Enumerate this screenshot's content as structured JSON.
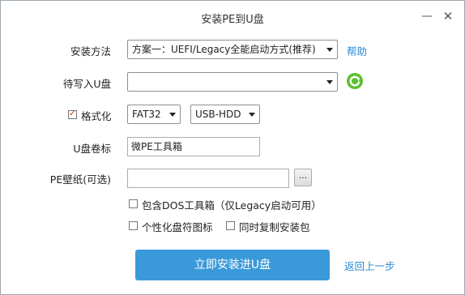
{
  "window": {
    "title": "安装PE到U盘",
    "minimize_icon": "minimize-icon",
    "close_icon": "close-icon"
  },
  "install_method": {
    "label": "安装方法",
    "value": "方案一：UEFI/Legacy全能启动方式(推荐)",
    "help": "帮助"
  },
  "target_drive": {
    "label": "待写入U盘",
    "value": "",
    "refresh_icon": "refresh-icon"
  },
  "format": {
    "label": "格式化",
    "checked": true,
    "filesystem": "FAT32",
    "mode": "USB-HDD"
  },
  "volume_label": {
    "label": "U盘卷标",
    "value": "微PE工具箱"
  },
  "wallpaper": {
    "label": "PE壁纸(可选)",
    "value": "",
    "browse": "..."
  },
  "options": {
    "dos_toolbox": "包含DOS工具箱（仅Legacy启动可用）",
    "personalize_icon": "个性化盘符图标",
    "copy_installer": "同时复制安装包"
  },
  "actions": {
    "install": "立即安装进U盘",
    "back": "返回上一步"
  },
  "colors": {
    "accent": "#3a9ad9",
    "link": "#2a8ad4",
    "refresh": "#4caf2a"
  }
}
